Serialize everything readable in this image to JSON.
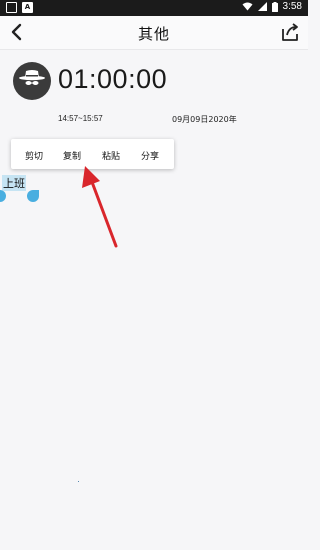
{
  "status_bar": {
    "time": "3:58",
    "left_icons": [
      "notification-box-icon",
      "app-a-icon"
    ],
    "right_icons": [
      "wifi-icon",
      "signal-icon",
      "battery-icon"
    ]
  },
  "header": {
    "title": "其他"
  },
  "record": {
    "duration": "01:00:00",
    "time_range": "14:57~15:57",
    "date": "09月09日2020年"
  },
  "context_menu": {
    "items": [
      "剪切",
      "复制",
      "粘贴",
      "分享"
    ]
  },
  "content": {
    "selected_text": "上班"
  },
  "colors": {
    "selection": "#c6e4f3",
    "handle": "#49aee0",
    "arrow": "#d9262c"
  }
}
